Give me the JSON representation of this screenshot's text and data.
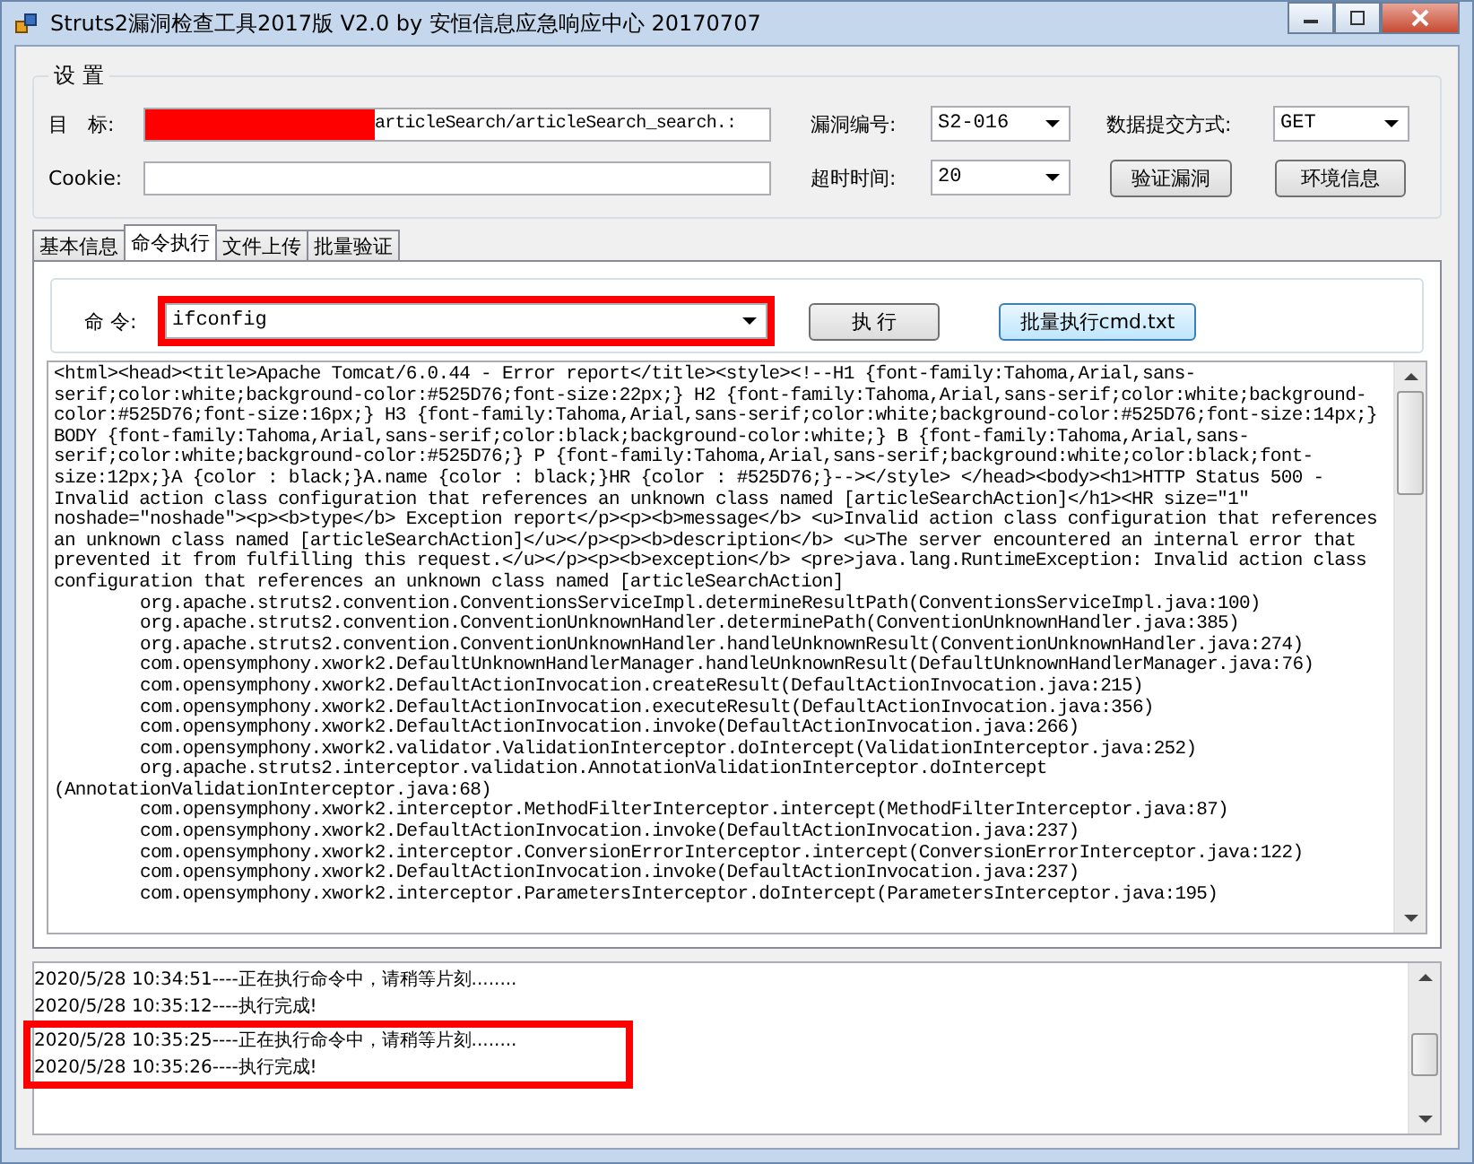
{
  "window": {
    "title": "Struts2漏洞检查工具2017版 V2.0 by 安恒信息应急响应中心 20170707"
  },
  "settings": {
    "title": "设 置",
    "target": {
      "label": "目　标:",
      "value": "articleSearch/articleSearch_search.:",
      "redacted": true
    },
    "cookie": {
      "label": "Cookie:"
    },
    "vuln_id": {
      "label": "漏洞编号:",
      "value": "S2-016"
    },
    "method": {
      "label": "数据提交方式:",
      "value": "GET"
    },
    "timeout": {
      "label": "超时时间:",
      "value": "20"
    },
    "buttons": [
      "验证漏洞",
      "环境信息"
    ]
  },
  "tabs": [
    {
      "label": "基本信息",
      "selected": false
    },
    {
      "label": "命令执行",
      "selected": true
    },
    {
      "label": "文件上传",
      "selected": false
    },
    {
      "label": "批量验证",
      "selected": false
    }
  ],
  "command": {
    "label": "命 令:",
    "value": "ifconfig",
    "highlighted": true,
    "run_button": "执 行",
    "batch_button": "批量执行cmd.txt"
  },
  "output": [
    {
      "text": "<html><head><title>Apache Tomcat/6.0.44 - Error report</title><style><!--H1 {font-family:Tahoma,Arial,sans-",
      "indented": false
    },
    {
      "text": "serif;color:white;background-color:#525D76;font-size:22px;} H2 {font-family:Tahoma,Arial,sans-serif;color:white;background-",
      "indented": false
    },
    {
      "text": "color:#525D76;font-size:16px;} H3 {font-family:Tahoma,Arial,sans-serif;color:white;background-color:#525D76;font-size:14px;}",
      "indented": false
    },
    {
      "text": "BODY {font-family:Tahoma,Arial,sans-serif;color:black;background-color:white;} B {font-family:Tahoma,Arial,sans-",
      "indented": false
    },
    {
      "text": "serif;color:white;background-color:#525D76;} P {font-family:Tahoma,Arial,sans-serif;background:white;color:black;font-",
      "indented": false
    },
    {
      "text": "size:12px;}A {color : black;}A.name {color : black;}HR {color : #525D76;}--></style> </head><body><h1>HTTP Status 500 -",
      "indented": false
    },
    {
      "text": "Invalid action class configuration that references an unknown class named [articleSearchAction]</h1><HR size=\"1\"",
      "indented": false
    },
    {
      "text": "noshade=\"noshade\"><p><b>type</b> Exception report</p><p><b>message</b> <u>Invalid action class configuration that references",
      "indented": false
    },
    {
      "text": "an unknown class named [articleSearchAction]</u></p><p><b>description</b> <u>The server encountered an internal error that",
      "indented": false
    },
    {
      "text": "prevented it from fulfilling this request.</u></p><p><b>exception</b> <pre>java.lang.RuntimeException: Invalid action class",
      "indented": false
    },
    {
      "text": "configuration that references an unknown class named [articleSearchAction]",
      "indented": false
    },
    {
      "text": "org.apache.struts2.convention.ConventionsServiceImpl.determineResultPath(ConventionsServiceImpl.java:100)",
      "indented": true
    },
    {
      "text": "org.apache.struts2.convention.ConventionUnknownHandler.determinePath(ConventionUnknownHandler.java:385)",
      "indented": true
    },
    {
      "text": "org.apache.struts2.convention.ConventionUnknownHandler.handleUnknownResult(ConventionUnknownHandler.java:274)",
      "indented": true
    },
    {
      "text": "com.opensymphony.xwork2.DefaultUnknownHandlerManager.handleUnknownResult(DefaultUnknownHandlerManager.java:76)",
      "indented": true
    },
    {
      "text": "com.opensymphony.xwork2.DefaultActionInvocation.createResult(DefaultActionInvocation.java:215)",
      "indented": true
    },
    {
      "text": "com.opensymphony.xwork2.DefaultActionInvocation.executeResult(DefaultActionInvocation.java:356)",
      "indented": true
    },
    {
      "text": "com.opensymphony.xwork2.DefaultActionInvocation.invoke(DefaultActionInvocation.java:266)",
      "indented": true
    },
    {
      "text": "com.opensymphony.xwork2.validator.ValidationInterceptor.doIntercept(ValidationInterceptor.java:252)",
      "indented": true
    },
    {
      "text": "org.apache.struts2.interceptor.validation.AnnotationValidationInterceptor.doIntercept",
      "indented": true
    },
    {
      "text": "(AnnotationValidationInterceptor.java:68)",
      "indented": false
    },
    {
      "text": "com.opensymphony.xwork2.interceptor.MethodFilterInterceptor.intercept(MethodFilterInterceptor.java:87)",
      "indented": true
    },
    {
      "text": "com.opensymphony.xwork2.DefaultActionInvocation.invoke(DefaultActionInvocation.java:237)",
      "indented": true
    },
    {
      "text": "com.opensymphony.xwork2.interceptor.ConversionErrorInterceptor.intercept(ConversionErrorInterceptor.java:122)",
      "indented": true
    },
    {
      "text": "com.opensymphony.xwork2.DefaultActionInvocation.invoke(DefaultActionInvocation.java:237)",
      "indented": true
    },
    {
      "text": "com.opensymphony.xwork2.interceptor.ParametersInterceptor.doIntercept(ParametersInterceptor.java:195)",
      "indented": true
    }
  ],
  "log": [
    {
      "text": "2020/5/28 10:34:51----正在执行命令中，请稍等片刻........",
      "highlighted": false
    },
    {
      "text": "2020/5/28 10:35:12----执行完成!",
      "highlighted": false
    },
    {
      "text": "2020/5/28 10:35:25----正在执行命令中，请稍等片刻........",
      "highlighted": true
    },
    {
      "text": "2020/5/28 10:35:26----执行完成!",
      "highlighted": true
    }
  ]
}
